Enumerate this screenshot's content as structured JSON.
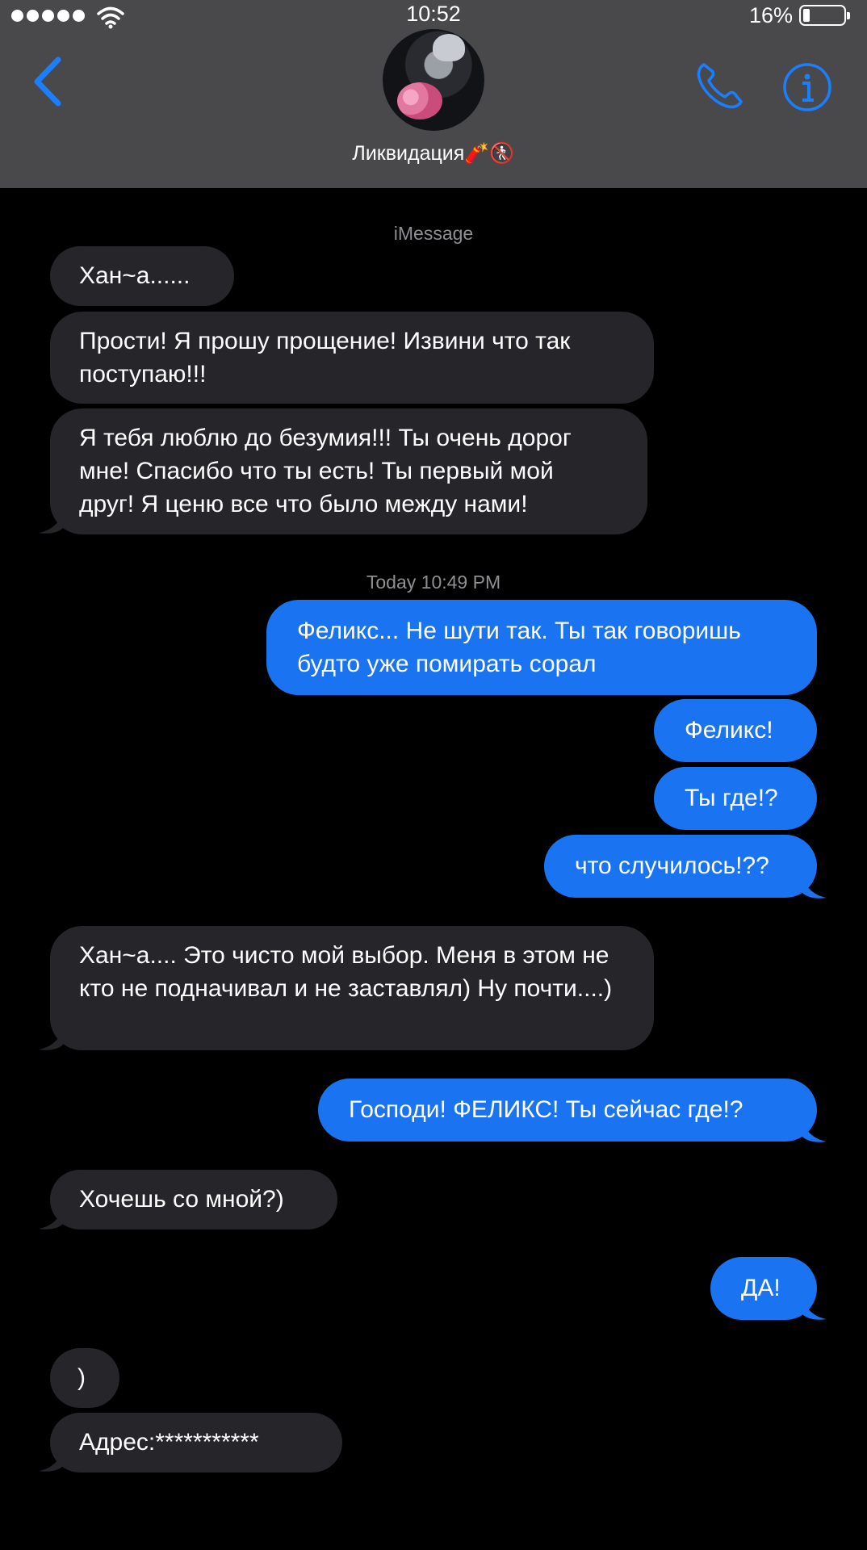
{
  "status_bar": {
    "time": "10:52",
    "battery_percent": "16%",
    "battery_level": 0.16,
    "signal_bars": 5
  },
  "header": {
    "contact_name": "Ликвидация",
    "contact_emoji": "🧨🚷",
    "back_icon": "chevron-left-icon",
    "call_icon": "phone-icon",
    "info_icon": "info-icon"
  },
  "conversation": {
    "service_label": "iMessage",
    "timestamp": "Today 10:49 PM",
    "messages": [
      {
        "direction": "in",
        "text": "Хан~а......"
      },
      {
        "direction": "in",
        "text": "Прости! Я прошу прощение! Извини что так поступаю!!!"
      },
      {
        "direction": "in",
        "text": "Я тебя люблю до безумия!!! Ты очень дорог мне! Спасибо что ты есть! Ты первый мой друг! Я ценю все что было между нами!"
      },
      {
        "direction": "out",
        "text": "Феликс... Не шути так. Ты так говоришь будто уже помирать сорал"
      },
      {
        "direction": "out",
        "text": "Феликс!"
      },
      {
        "direction": "out",
        "text": "Ты где!?"
      },
      {
        "direction": "out",
        "text": "что случилось!??"
      },
      {
        "direction": "in",
        "text": "Хан~а.... Это чисто мой выбор. Меня в этом не кто не подначивал и не заставлял) Ну почти....)"
      },
      {
        "direction": "out",
        "text": "Господи! ФЕЛИКС! Ты сейчас где!?"
      },
      {
        "direction": "in",
        "text": "Хочешь со мной?)"
      },
      {
        "direction": "out",
        "text": "ДА!"
      },
      {
        "direction": "in",
        "text": ")"
      },
      {
        "direction": "in",
        "text": "Адрес:***********"
      }
    ]
  },
  "colors": {
    "header_bg": "#49494b",
    "background": "#000000",
    "incoming_bubble": "#26252a",
    "outgoing_bubble": "#1a73f0",
    "accent": "#1a73f0",
    "meta_text": "#8e8e93"
  }
}
